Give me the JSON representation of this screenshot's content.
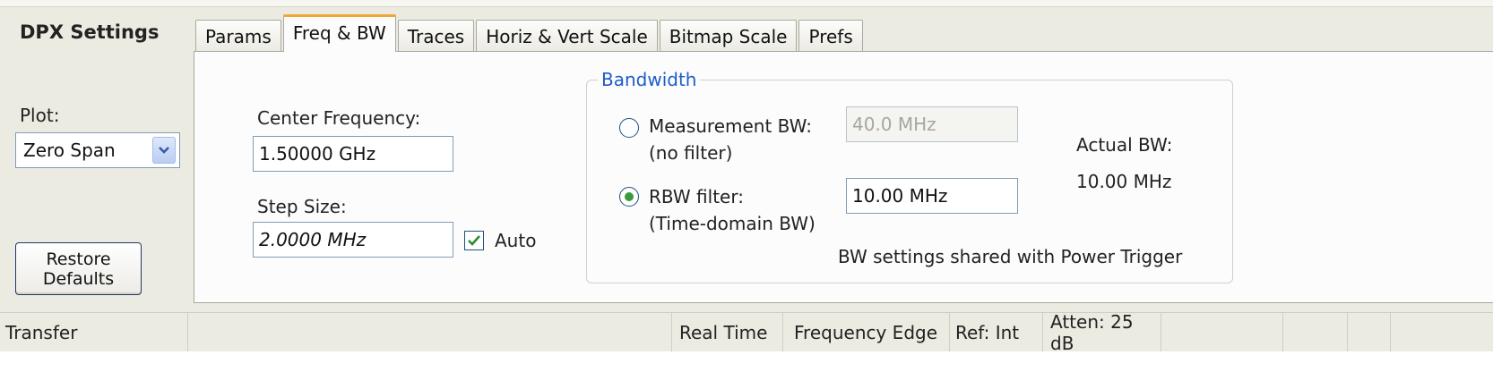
{
  "panel": {
    "title": "DPX Settings",
    "plot_label": "Plot:",
    "plot_value": "Zero Span",
    "restore_line1": "Restore",
    "restore_line2": "Defaults"
  },
  "tabs": [
    {
      "label": "Params",
      "active": false
    },
    {
      "label": "Freq & BW",
      "active": true
    },
    {
      "label": "Traces",
      "active": false
    },
    {
      "label": "Horiz & Vert Scale",
      "active": false
    },
    {
      "label": "Bitmap Scale",
      "active": false
    },
    {
      "label": "Prefs",
      "active": false
    }
  ],
  "freq": {
    "center_label": "Center Frequency:",
    "center_value": "1.50000 GHz",
    "step_label": "Step Size:",
    "step_value": "2.0000 MHz",
    "auto_label": "Auto",
    "auto_checked": true
  },
  "bandwidth": {
    "group_label": "Bandwidth",
    "meas_label_1": "Measurement BW:",
    "meas_label_2": "(no filter)",
    "meas_value": "40.0 MHz",
    "meas_selected": false,
    "rbw_label_1": "RBW filter:",
    "rbw_label_2": "(Time-domain BW)",
    "rbw_value": "10.00 MHz",
    "rbw_selected": true,
    "actual_label": "Actual BW:",
    "actual_value": "10.00 MHz",
    "shared_note": "BW settings shared with Power Trigger"
  },
  "statusbar": {
    "transfer": "Transfer",
    "real_time": "Real Time",
    "trigger": "Frequency Edge",
    "ref": "Ref: Int",
    "atten": "Atten: 25 dB"
  },
  "colors": {
    "accent_tab": "#f0a53a",
    "group_label": "#1f5cc8",
    "radio_selected": "#3c9a3c",
    "check_mark": "#2e8b2e"
  }
}
